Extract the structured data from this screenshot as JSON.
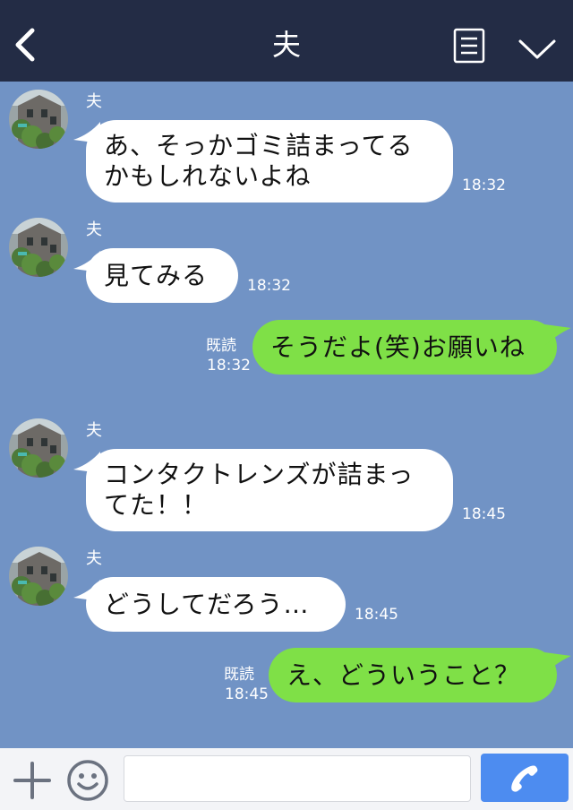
{
  "header": {
    "title": "夫",
    "back_icon": "chevron-left-icon",
    "menu_icon": "menu-icon",
    "collapse_icon": "chevron-down-icon"
  },
  "messages": [
    {
      "direction": "in",
      "sender": "夫",
      "text": "あ、そっかゴミ詰まってる\nかもしれないよね",
      "time": "18:32"
    },
    {
      "direction": "in",
      "sender": "夫",
      "text": "見てみる",
      "time": "18:32"
    },
    {
      "direction": "out",
      "read": "既読",
      "text": "そうだよ(笑)お願いね",
      "time": "18:32"
    },
    {
      "direction": "in",
      "sender": "夫",
      "text": "コンタクトレンズが詰まっ\nてた！！",
      "time": "18:45"
    },
    {
      "direction": "in",
      "sender": "夫",
      "text": "どうしてだろう…",
      "time": "18:45"
    },
    {
      "direction": "out",
      "read": "既読",
      "text": "え、どういうこと？",
      "time": "18:45"
    }
  ],
  "footer": {
    "input_value": "",
    "plus_icon": "plus-icon",
    "emoji_icon": "smiley-icon",
    "call_icon": "phone-icon"
  },
  "colors": {
    "header_bg": "#232c45",
    "chat_bg": "#7193c5",
    "incoming_bubble": "#ffffff",
    "outgoing_bubble": "#7fe047",
    "call_button": "#4d8cf0"
  }
}
